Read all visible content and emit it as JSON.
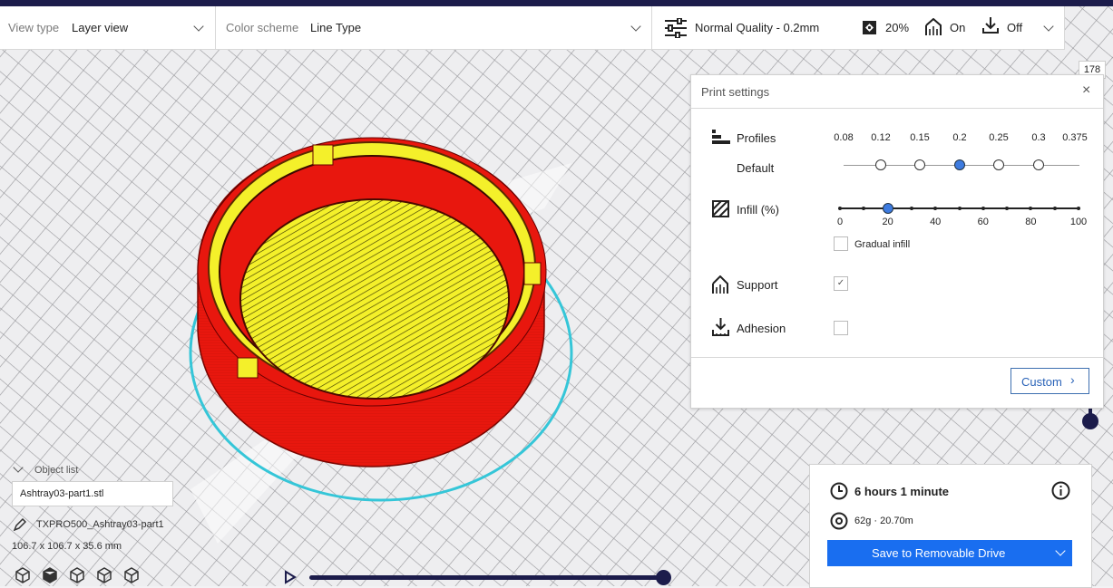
{
  "toolbar": {
    "view_type_label": "View type",
    "view_type_value": "Layer view",
    "color_scheme_label": "Color scheme",
    "color_scheme_value": "Line Type",
    "quality_label": "Normal Quality - 0.2mm",
    "infill_value": "20%",
    "support_value": "On",
    "adhesion_value": "Off"
  },
  "layer_number": "178",
  "print_settings": {
    "title": "Print settings",
    "profiles_label": "Profiles",
    "profile_default": "Default",
    "profile_ticks": [
      "0.08",
      "0.12",
      "0.15",
      "0.2",
      "0.25",
      "0.3",
      "0.375"
    ],
    "profile_selected": "0.2",
    "infill_label": "Infill (%)",
    "infill_ticks": [
      "0",
      "20",
      "40",
      "60",
      "80",
      "100"
    ],
    "infill_percent": 20,
    "gradual_infill_label": "Gradual infill",
    "gradual_infill_checked": false,
    "support_label": "Support",
    "support_checked": true,
    "adhesion_label": "Adhesion",
    "adhesion_checked": false,
    "custom_button": "Custom"
  },
  "job": {
    "time": "6 hours 1 minute",
    "material": "62g · 20.70m",
    "save_button": "Save to Removable Drive"
  },
  "object_list": {
    "header": "Object list",
    "selected_file": "Ashtray03-part1.stl",
    "job_name": "TXPRO500_Ashtray03-part1",
    "dimensions": "106.7 x 106.7 x 35.6 mm"
  },
  "colors": {
    "accent": "#196ef0",
    "topbar": "#1c1c4b",
    "model_wall": "#e8170e",
    "model_infill": "#f2ef2a",
    "outline": "#35c6d8"
  }
}
